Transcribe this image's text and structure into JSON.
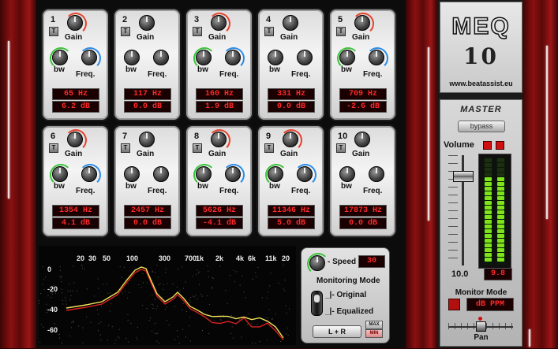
{
  "bands": [
    {
      "num": "1",
      "gain_label": "Gain",
      "bw_label": "bw",
      "freq_label": "Freq.",
      "freq": "65",
      "freq_unit": "Hz",
      "gain": "6.2",
      "gain_unit": "dB",
      "active": true
    },
    {
      "num": "2",
      "gain_label": "Gain",
      "bw_label": "bw",
      "freq_label": "Freq.",
      "freq": "117",
      "freq_unit": "Hz",
      "gain": "0.0",
      "gain_unit": "dB",
      "active": false
    },
    {
      "num": "3",
      "gain_label": "Gain",
      "bw_label": "bw",
      "freq_label": "Freq.",
      "freq": "160",
      "freq_unit": "Hz",
      "gain": "1.9",
      "gain_unit": "dB",
      "active": true
    },
    {
      "num": "4",
      "gain_label": "Gain",
      "bw_label": "bw",
      "freq_label": "Freq.",
      "freq": "331",
      "freq_unit": "Hz",
      "gain": "0.0",
      "gain_unit": "dB",
      "active": false
    },
    {
      "num": "5",
      "gain_label": "Gain",
      "bw_label": "bw",
      "freq_label": "Freq.",
      "freq": "709",
      "freq_unit": "Hz",
      "gain": "-2.6",
      "gain_unit": "dB",
      "active": true
    },
    {
      "num": "6",
      "gain_label": "Gain",
      "bw_label": "bw",
      "freq_label": "Freq.",
      "freq": "1354",
      "freq_unit": "Hz",
      "gain": "4.1",
      "gain_unit": "dB",
      "active": true
    },
    {
      "num": "7",
      "gain_label": "Gain",
      "bw_label": "bw",
      "freq_label": "Freq.",
      "freq": "2457",
      "freq_unit": "Hz",
      "gain": "0.0",
      "gain_unit": "dB",
      "active": false
    },
    {
      "num": "8",
      "gain_label": "Gain",
      "bw_label": "bw",
      "freq_label": "Freq.",
      "freq": "5626",
      "freq_unit": "Hz",
      "gain": "-4.1",
      "gain_unit": "dB",
      "active": true
    },
    {
      "num": "9",
      "gain_label": "Gain",
      "bw_label": "bw",
      "freq_label": "Freq.",
      "freq": "11346",
      "freq_unit": "Hz",
      "gain": "5.0",
      "gain_unit": "dB",
      "active": true
    },
    {
      "num": "10",
      "gain_label": "Gain",
      "bw_label": "bw",
      "freq_label": "Freq.",
      "freq": "17873",
      "freq_unit": "Hz",
      "gain": "0.0",
      "gain_unit": "dB",
      "active": false
    }
  ],
  "t_label": "T",
  "analyzer": {
    "freq_ticks": [
      "20",
      "30",
      "50",
      "100",
      "300",
      "700",
      "1k",
      "2k",
      "4k",
      "6k",
      "11k",
      "20"
    ],
    "db_ticks": [
      "0",
      "-20",
      "-40",
      "-60"
    ]
  },
  "controls": {
    "speed_label": "- Speed",
    "speed_value": "30",
    "monitoring_title": "Monitoring Mode",
    "original_label": "_|- Original",
    "equalized_label": "_|- Equalized",
    "lr_label": "L + R",
    "max_label": "MAX",
    "min_label": "MIN"
  },
  "logo": {
    "title_top": "MEQ",
    "title_bottom": "10",
    "url": "www.beatassist.eu"
  },
  "master": {
    "title": "MASTER",
    "bypass_label": "bypass",
    "volume_label": "Volume",
    "volume_value": "10.0",
    "meter_value": "9.8",
    "meter_level": 0.82,
    "monitor_mode_label": "Monitor Mode",
    "monitor_mode_value": "dB PPM",
    "pan_label": "Pan"
  },
  "colors": {
    "readout_red": "#ff2a2a",
    "meter_green": "#7ee31a",
    "meter_red": "#e01010",
    "curve_yellow": "#f2e25a",
    "curve_red": "#d82020"
  }
}
